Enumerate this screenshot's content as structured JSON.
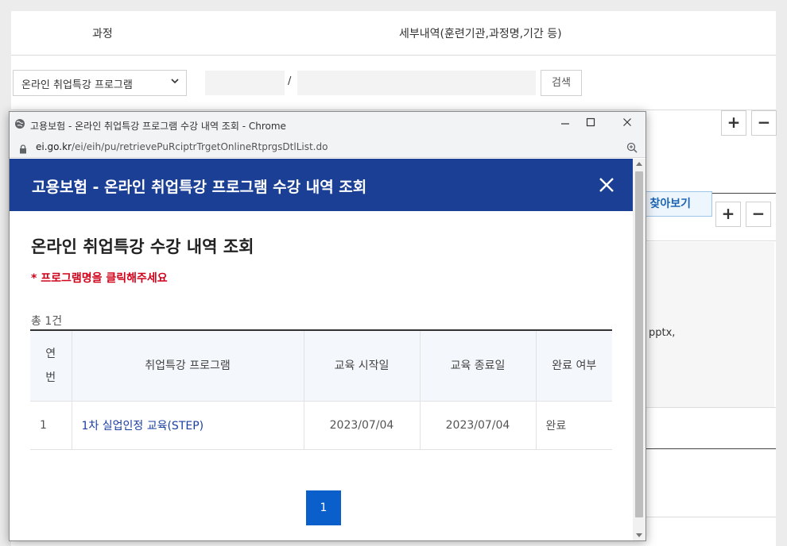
{
  "background": {
    "header": {
      "col_course": "과정",
      "col_detail": "세부내역(훈련기관,과정명,기간 등)"
    },
    "filter": {
      "select_value": "온라인 취업특강 프로그램",
      "slash": "/",
      "search_label": "검색"
    },
    "find_label": "찾아보기",
    "plus": "+",
    "minus": "−",
    "pptx_text": "pptx,"
  },
  "window": {
    "title": "고용보험 - 온라인 취업특강 프로그램 수강 내역 조회 - Chrome",
    "url_host": "ei.go.kr",
    "url_path": "/ei/eih/pu/retrievePuRciptrTrgetOnlineRtprgsDtlList.do"
  },
  "modal": {
    "title": "고용보험 - 온라인 취업특강 프로그램 수강 내역 조회",
    "section_title": "온라인 취업특강 수강 내역 조회",
    "notice": "* 프로그램명을 클릭해주세요",
    "total": "총 1건",
    "table": {
      "headers": {
        "no_1": "연",
        "no_2": "번",
        "program": "취업특강 프로그램",
        "start": "교육 시작일",
        "end": "교육 종료일",
        "done": "완료 여부"
      },
      "rows": [
        {
          "no": "1",
          "program": "1차 실업인정 교육(STEP)",
          "start": "2023/07/04",
          "end": "2023/07/04",
          "done": "완료"
        }
      ]
    },
    "pagination": {
      "current": "1"
    }
  }
}
